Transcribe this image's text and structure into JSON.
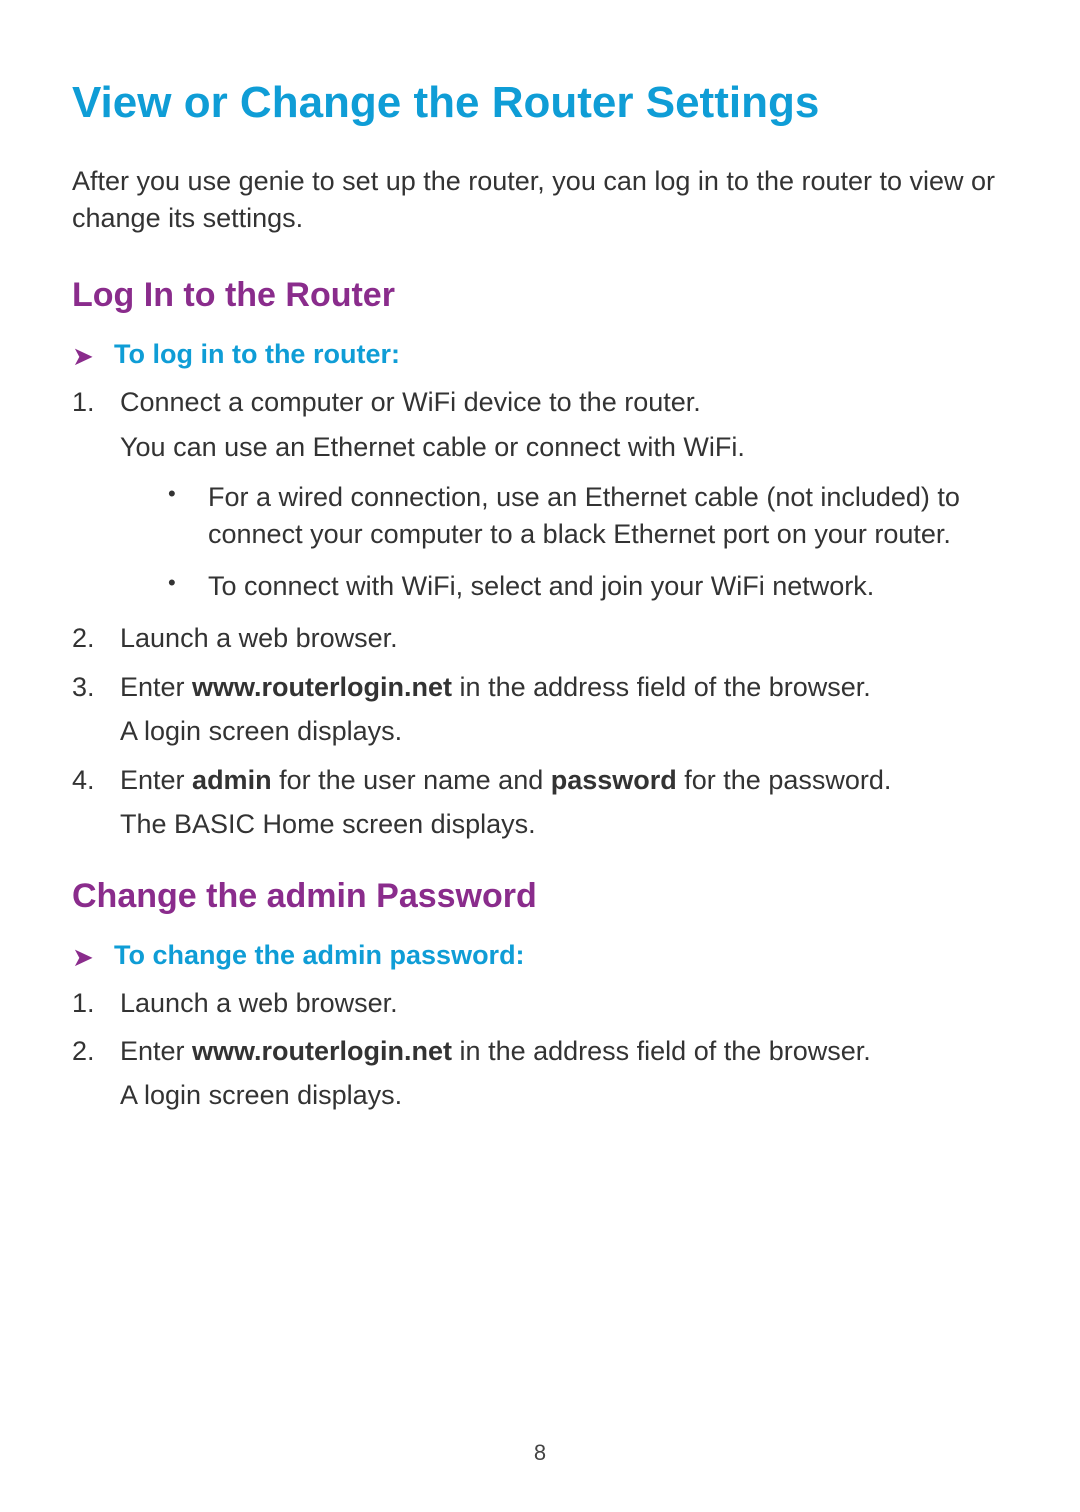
{
  "page_number": "8",
  "h1": "View or Change the Router Settings",
  "intro": "After you use genie to set up the router, you can log in to the router to view or change its settings.",
  "section1": {
    "h2": "Log In to the Router",
    "proc_title": "To log in to the router:",
    "steps": {
      "s1": {
        "text": "Connect a computer or WiFi device to the router.",
        "note": "You can use an Ethernet cable or connect with WiFi.",
        "bullets": {
          "b1": "For a wired connection, use an Ethernet cable (not included) to connect your computer to a black Ethernet port on your router.",
          "b2": "To connect with WiFi, select and join your WiFi network."
        }
      },
      "s2": {
        "text": "Launch a web browser."
      },
      "s3": {
        "pre": "Enter ",
        "bold": "www.routerlogin.net",
        "post": " in the address field of the browser.",
        "note": "A login screen displays."
      },
      "s4": {
        "pre": "Enter ",
        "bold1": "admin",
        "mid": " for the user name and ",
        "bold2": "password",
        "post": " for the password.",
        "note": "The BASIC Home screen displays."
      }
    }
  },
  "section2": {
    "h2": "Change the admin Password",
    "proc_title": "To change the admin password:",
    "steps": {
      "s1": {
        "text": "Launch a web browser."
      },
      "s2": {
        "pre": "Enter ",
        "bold": "www.routerlogin.net",
        "post": " in the address field of the browser.",
        "note": "A login screen displays."
      }
    }
  }
}
